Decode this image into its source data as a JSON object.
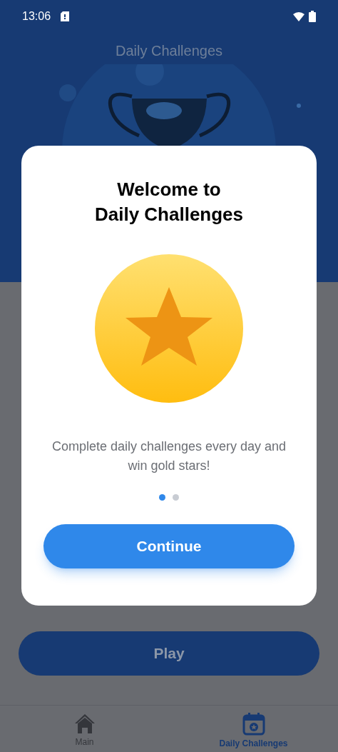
{
  "status_bar": {
    "time": "13:06"
  },
  "header": {
    "title": "Daily Challenges"
  },
  "play_button": {
    "label": "Play"
  },
  "bottom_nav": [
    {
      "label": "Main",
      "selected": false
    },
    {
      "label": "Daily Challenges",
      "selected": true
    }
  ],
  "dialog": {
    "title": "Welcome to\nDaily Challenges",
    "message": "Complete daily challenges every day and win gold stars!",
    "pages": [
      {
        "selected": true
      },
      {
        "selected": false
      }
    ],
    "button": "Continue"
  }
}
